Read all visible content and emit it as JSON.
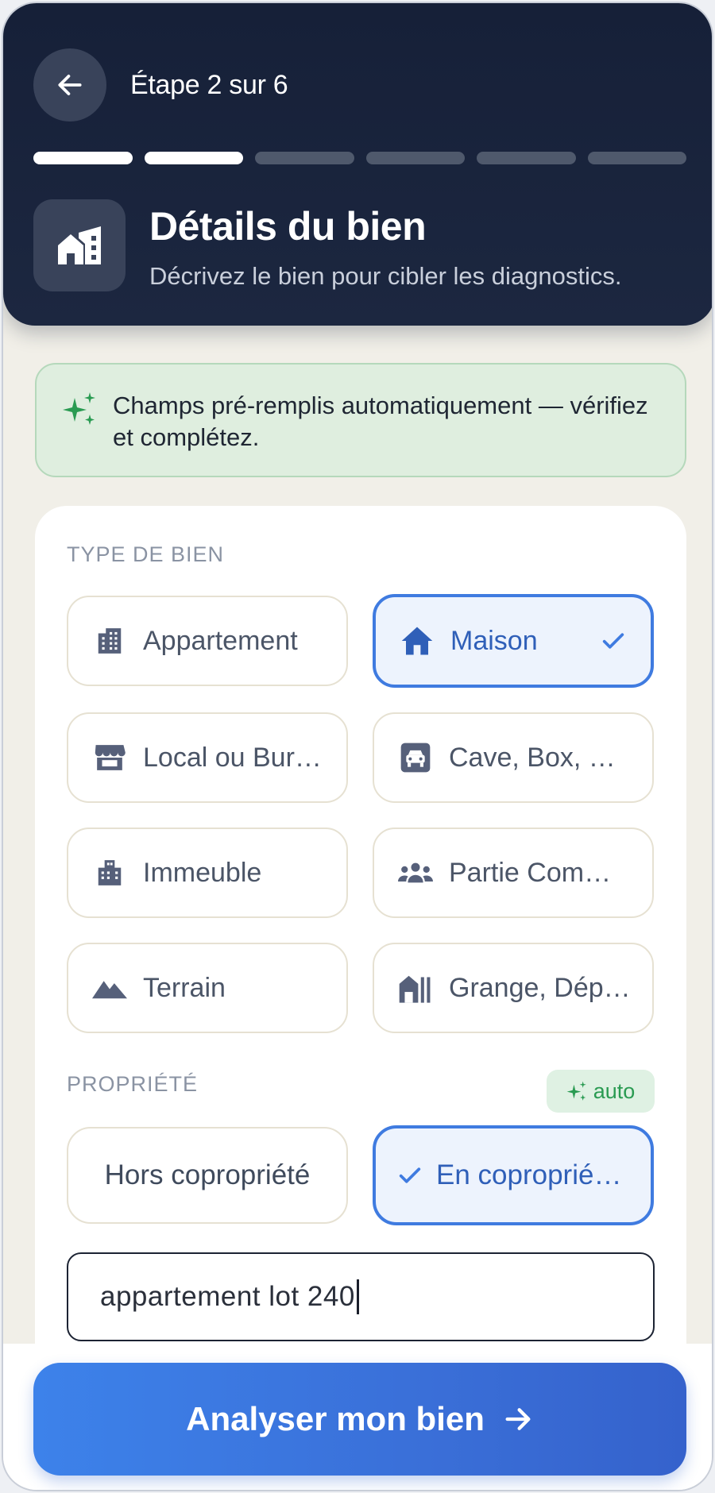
{
  "header": {
    "step_label": "Étape 2 sur 6",
    "progress": {
      "current": 2,
      "total": 6
    },
    "title": "Détails du bien",
    "subtitle": "Décrivez le bien pour cibler les diagnostics."
  },
  "banner": {
    "icon": "sparkle-icon",
    "text": "Champs pré-remplis automatiquement — vérifiez et complétez."
  },
  "property_type": {
    "label": "TYPE DE BIEN",
    "options": [
      {
        "label": "Appartement",
        "icon": "apartment-building-icon",
        "selected": false
      },
      {
        "label": "Maison",
        "icon": "house-icon",
        "selected": true
      },
      {
        "label": "Local ou Bur…",
        "icon": "storefront-icon",
        "selected": false
      },
      {
        "label": "Cave, Box, P…",
        "icon": "car-garage-icon",
        "selected": false
      },
      {
        "label": "Immeuble",
        "icon": "building-icon",
        "selected": false
      },
      {
        "label": "Partie Comm…",
        "icon": "people-group-icon",
        "selected": false
      },
      {
        "label": "Terrain",
        "icon": "mountain-icon",
        "selected": false
      },
      {
        "label": "Grange, Dép…",
        "icon": "barn-icon",
        "selected": false
      }
    ]
  },
  "ownership": {
    "label": "PROPRIÉTÉ",
    "auto_badge": "auto",
    "options": [
      {
        "label": "Hors copropriété",
        "selected": false
      },
      {
        "label": "En coproprié…",
        "selected": true
      }
    ],
    "input_value": "appartement lot 240"
  },
  "cta": {
    "label": "Analyser mon bien",
    "icon": "arrow-right-icon"
  },
  "colors": {
    "header_bg": "#1b2540",
    "accent": "#3f7be0",
    "success": "#2a9b52"
  }
}
